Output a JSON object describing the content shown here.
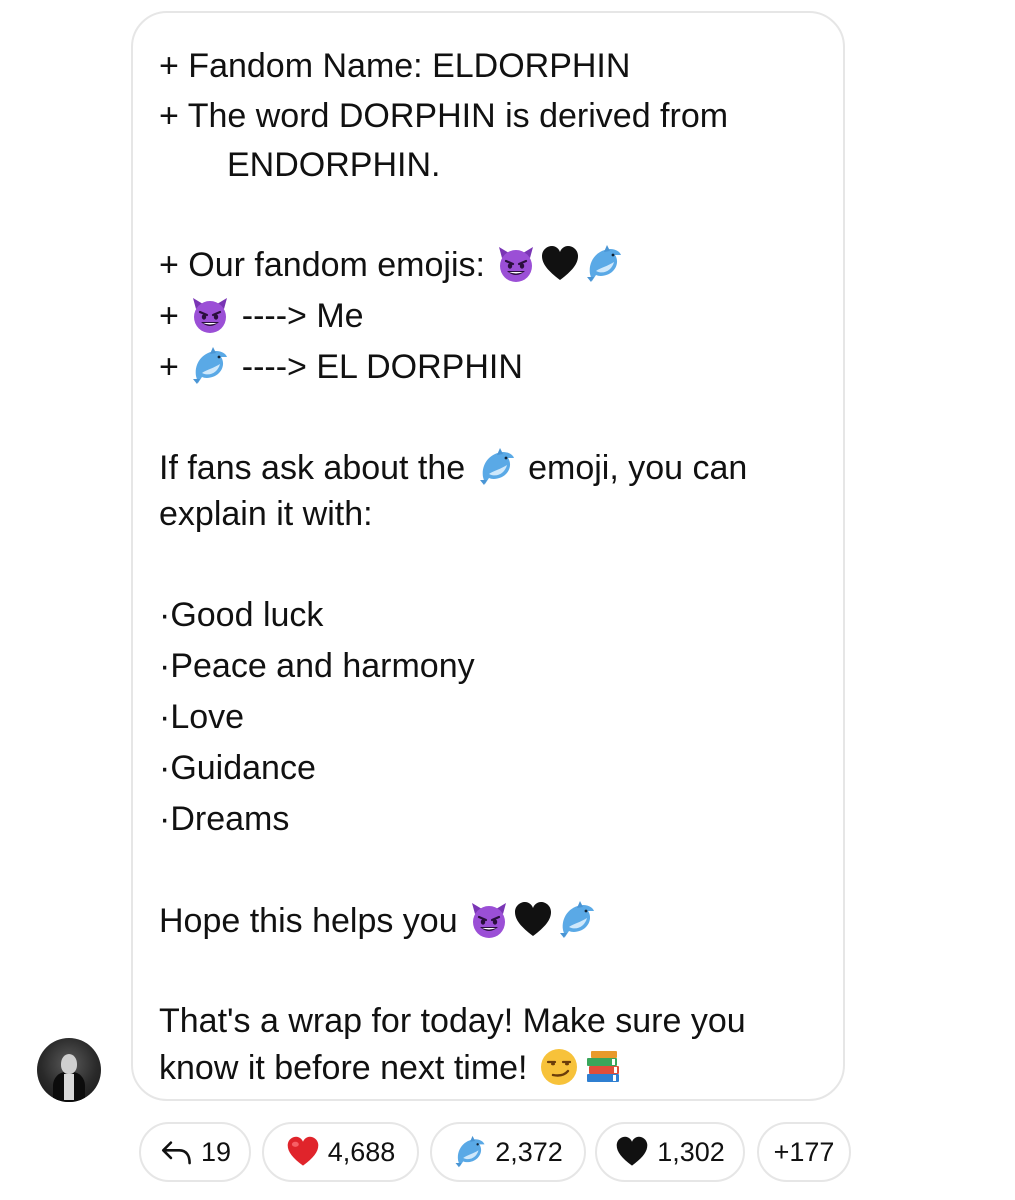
{
  "message": {
    "line1": "+ Fandom Name: ELDORPHIN",
    "line2": "+ The word DORPHIN is derived from",
    "line3": "ENDORPHIN.",
    "line4": "+ Our fandom emojis:",
    "line5_prefix": "+",
    "line5_suffix": "----> Me",
    "line6_prefix": "+",
    "line6_suffix": "----> EL DORPHIN",
    "line7_a": "If fans ask about the",
    "line7_b": "emoji, you can",
    "line8": "explain it with:",
    "bullets": [
      "·Good luck",
      "·Peace and harmony",
      "·Love",
      "·Guidance",
      "·Dreams"
    ],
    "closing1": "Hope this helps you",
    "closing2": "That's a wrap for today! Make sure you",
    "closing3": "know it before next time!"
  },
  "emojis": {
    "devil": "smiling-devil-icon",
    "heart": "black-heart-icon",
    "dolphin": "dolphin-icon",
    "smirk": "smirk-face-icon",
    "books": "books-icon"
  },
  "reactions": [
    {
      "icon": "reply-arrow-icon",
      "count": "19"
    },
    {
      "icon": "red-heart-icon",
      "count": "4,688"
    },
    {
      "icon": "dolphin-icon",
      "count": "2,372"
    },
    {
      "icon": "black-heart-icon",
      "count": "1,302"
    },
    {
      "icon": "more",
      "count": "+177"
    }
  ],
  "colors": {
    "bubble_border": "#e6e6e6",
    "text": "#111111",
    "devil_purple": "#8e44c9",
    "dolphin_blue": "#6ab3e8",
    "heart_red": "#e0242b"
  }
}
